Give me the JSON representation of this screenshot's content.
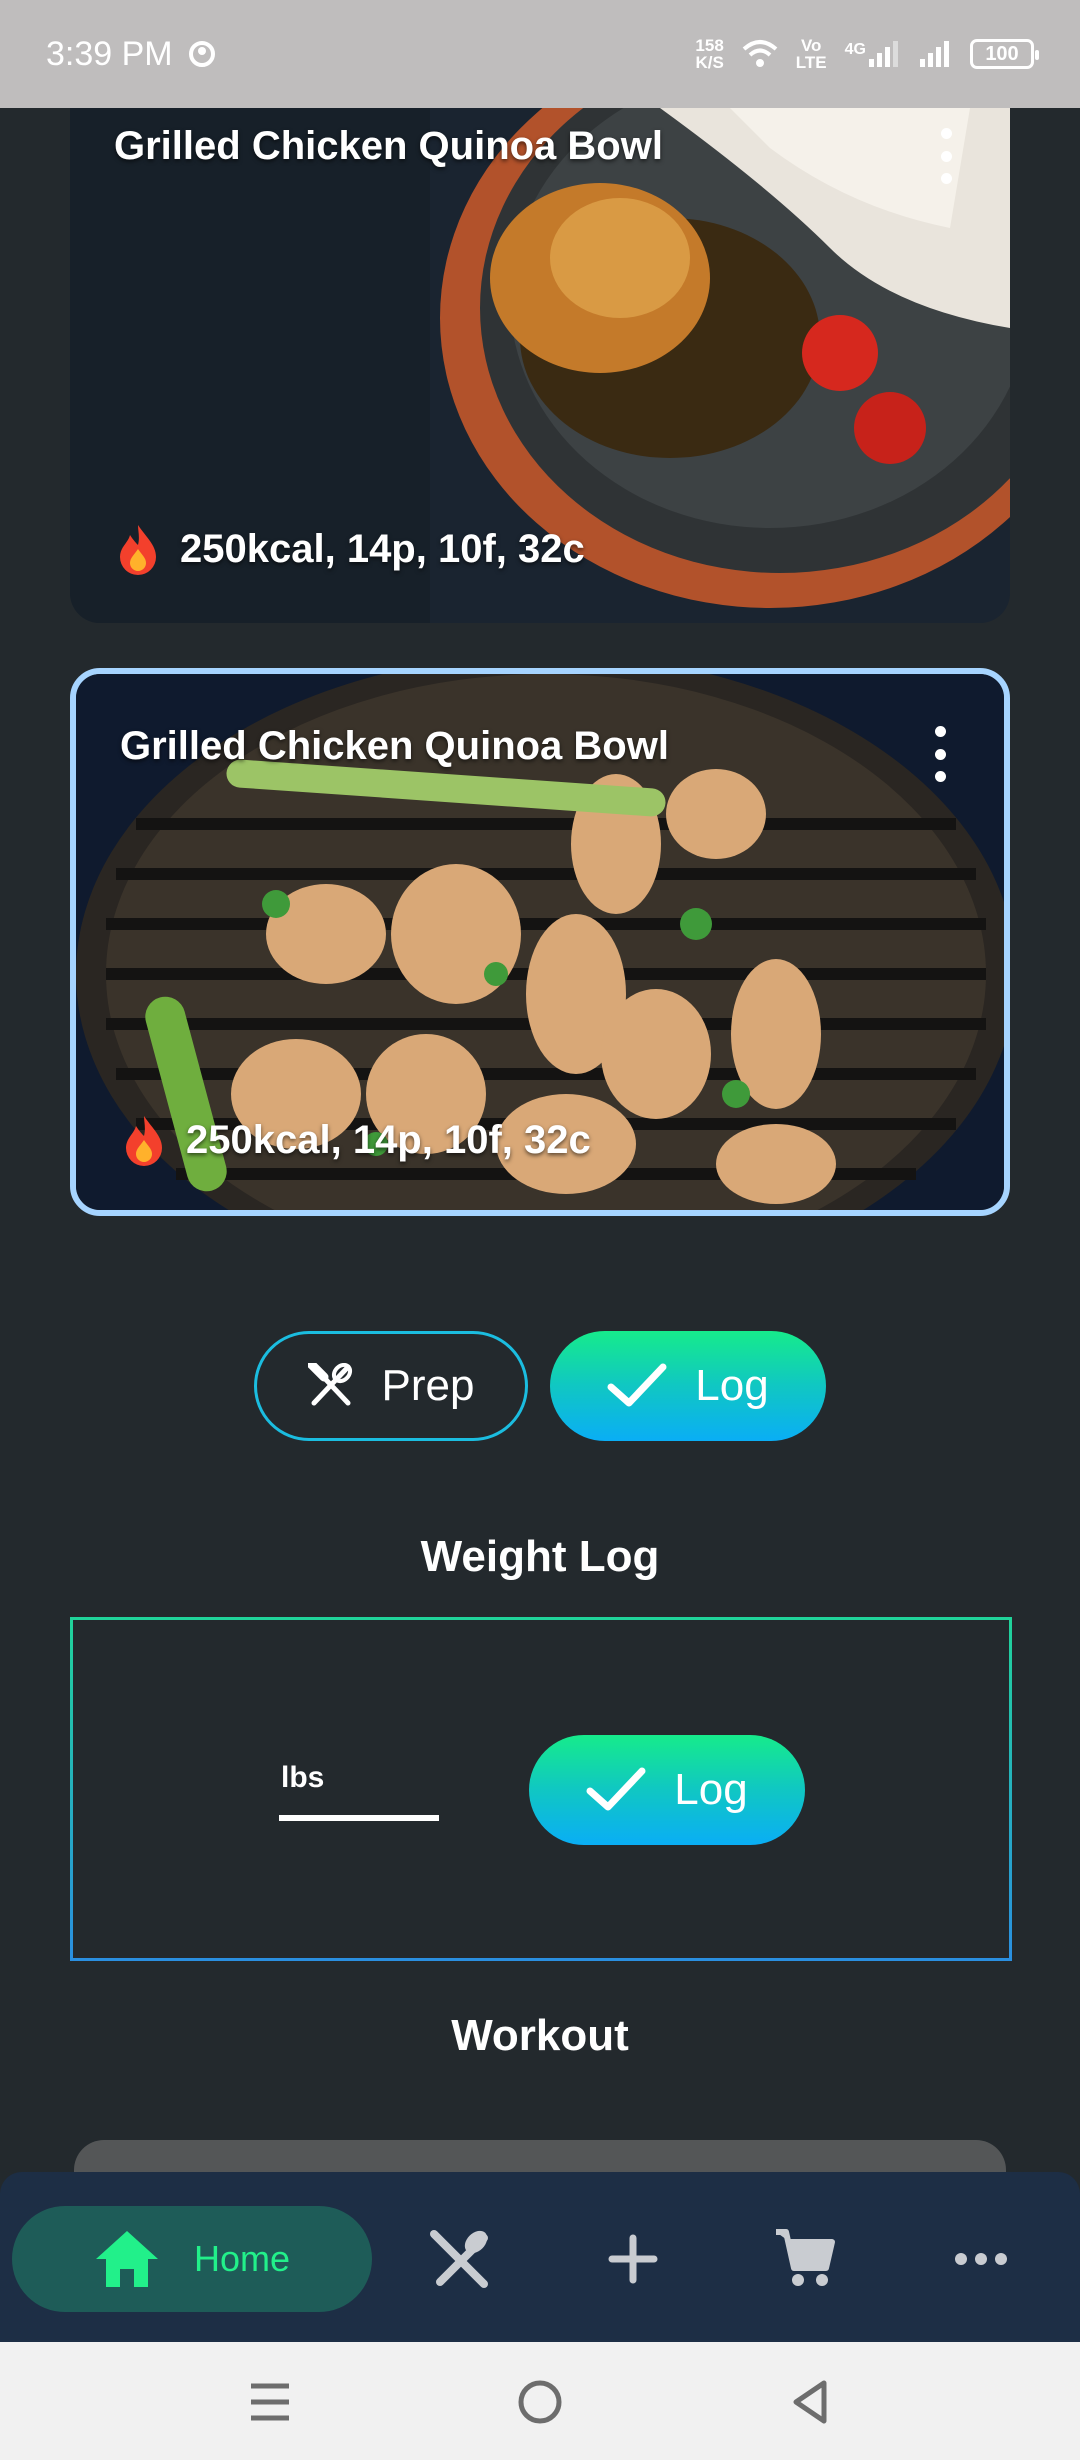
{
  "status_bar": {
    "time": "3:39 PM",
    "net_speed_value": "158",
    "net_speed_unit": "K/S",
    "volte_top": "Vo",
    "volte_bottom": "LTE",
    "network_type": "4G",
    "battery": "100"
  },
  "meals": [
    {
      "title": "Grilled Chicken Quinoa Bowl",
      "macros": "250kcal, 14p, 10f, 32c"
    },
    {
      "title": "Grilled Chicken Quinoa Bowl",
      "macros": "250kcal, 14p, 10f, 32c"
    }
  ],
  "actions": {
    "prep_label": "Prep",
    "log_label": "Log"
  },
  "weight_log": {
    "title": "Weight Log",
    "unit": "lbs",
    "log_label": "Log"
  },
  "workout": {
    "title": "Workout"
  },
  "bottom_nav": {
    "home_label": "Home",
    "items": [
      "home-icon",
      "utensils-icon",
      "plus-icon",
      "cart-icon",
      "more-icon"
    ]
  },
  "colors": {
    "background": "#23292d",
    "accent_green": "#16eb8b",
    "accent_blue": "#0aaef5",
    "nav_bg": "#1d2e45",
    "nav_active_bg": "#1e5c58",
    "selected_border": "#a6d4ff"
  }
}
